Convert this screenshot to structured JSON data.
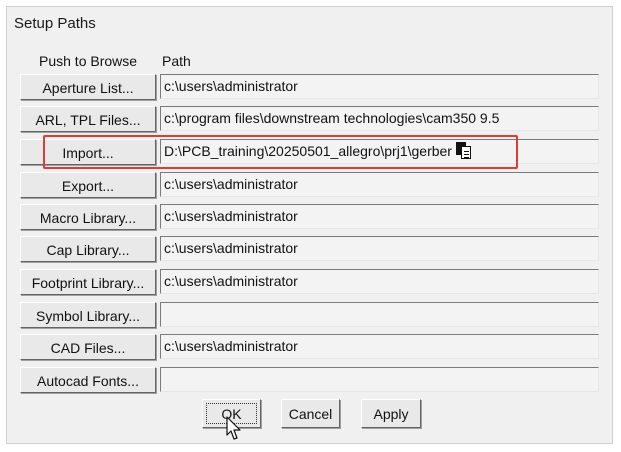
{
  "window": {
    "title": "Setup Paths"
  },
  "headers": {
    "push_to_browse": "Push to Browse",
    "path": "Path"
  },
  "rows": [
    {
      "button": "Aperture List...",
      "path": "c:\\users\\administrator"
    },
    {
      "button": "ARL, TPL Files...",
      "path": "c:\\program files\\downstream technologies\\cam350 9.5"
    },
    {
      "button": "Import...",
      "path": "D:\\PCB_training\\20250501_allegro\\prj1\\gerber"
    },
    {
      "button": "Export...",
      "path": "c:\\users\\administrator"
    },
    {
      "button": "Macro Library...",
      "path": "c:\\users\\administrator"
    },
    {
      "button": "Cap Library...",
      "path": "c:\\users\\administrator"
    },
    {
      "button": "Footprint Library...",
      "path": "c:\\users\\administrator"
    },
    {
      "button": "Symbol Library...",
      "path": ""
    },
    {
      "button": "CAD Files...",
      "path": "c:\\users\\administrator"
    },
    {
      "button": "Autocad Fonts...",
      "path": ""
    }
  ],
  "buttons": {
    "ok": "OK",
    "cancel": "Cancel",
    "apply": "Apply"
  },
  "icons": {
    "paste": "paste-icon",
    "cursor": "mouse-pointer-icon"
  },
  "colors": {
    "highlight": "#e53935",
    "dialog_bg": "#f0f0f0"
  }
}
